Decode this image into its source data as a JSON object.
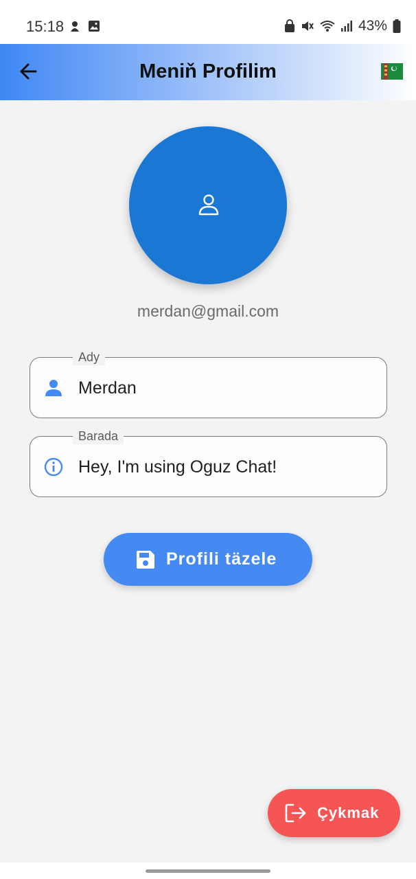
{
  "status_bar": {
    "time": "15:18",
    "battery_percent": "43%",
    "icons": [
      "notification-icon",
      "gallery-icon",
      "lock-icon",
      "mute-icon",
      "wifi-icon",
      "signal-icon",
      "battery-icon"
    ]
  },
  "app_bar": {
    "title": "Meniň Profilim",
    "back_icon": "arrow-back-icon",
    "flag_icon": "turkmenistan-flag-icon",
    "gradient_colors": [
      "#3f87f5",
      "#ffffff"
    ]
  },
  "profile": {
    "avatar_icon": "person-outline-icon",
    "avatar_color": "#1a77d4",
    "email": "merdan@gmail.com"
  },
  "fields": {
    "name": {
      "label": "Ady",
      "value": "Merdan",
      "icon": "person-icon"
    },
    "about": {
      "label": "Barada",
      "value": "Hey, I'm using Oguz Chat!",
      "icon": "info-icon"
    }
  },
  "update_button": {
    "label": "Profili täzele",
    "icon": "save-icon",
    "color": "#4589f2"
  },
  "logout_button": {
    "label": "Çykmak",
    "icon": "logout-icon",
    "color": "#f55555"
  }
}
